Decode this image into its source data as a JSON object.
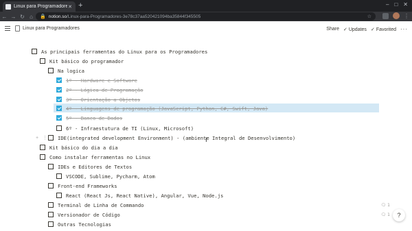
{
  "browser": {
    "tab_title": "Linux para Programadores",
    "new_tab_icon": "+",
    "url_host": "notion.so",
    "url_path": "/Linux-para-Programadores-3e78c37aa520421094ba35844f345505"
  },
  "topbar": {
    "page_title": "Linux para Programadores",
    "share_label": "Share",
    "updates_label": "Updates",
    "favorited_label": "Favorited",
    "more_label": "···"
  },
  "tree": {
    "root": "As principais ferramentas do Linux para os Programadores",
    "kit_basico": "Kit básico do programador",
    "na_logica": "Na logica",
    "item1": "1º - Hardware e Software",
    "item2": "2º - Lógica de Programação",
    "item3": "3º - Orientação a Objetos",
    "item4": "4º - Linguagens de programação (JavaScript, Python, C#, Swift, Java)",
    "item5": "5º - Banco de Dados",
    "item6": "6º - Infraestutura de TI (Linux, Microsoft)",
    "ide": "IDE(integrated development Environment) - (ambiente Integral de Desenvolvimento)",
    "kit_dia": "Kit básico do dia a dia",
    "como_instalar": "Como instalar ferramentas no Linux",
    "ides_editores": "IDEs e Editores de Textos",
    "vscode": "VSCODE, Sublime, Pycharm, Atom",
    "frontend": "Front-end Frameworks",
    "react": "React (React Js, React Native), Angular, Vue, Node.js",
    "terminal": "Terminal de Linha de Commando",
    "versionador": "Versionador de Código",
    "outras": "Outras Tecnologias"
  },
  "comments": {
    "terminal_count": "1",
    "versionador_count": "1"
  },
  "help": "?"
}
